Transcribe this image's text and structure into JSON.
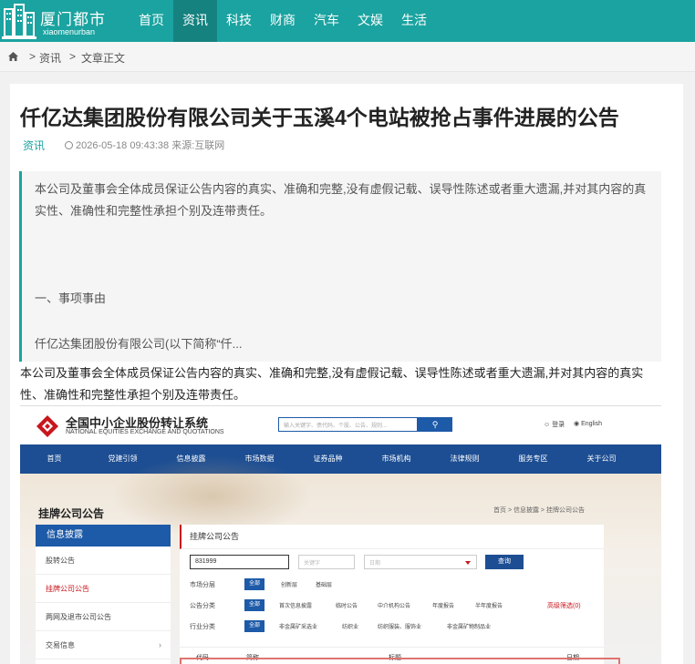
{
  "site": {
    "logo_cn": "厦门都市",
    "logo_en": "xiaomenurban",
    "nav": [
      "首页",
      "资讯",
      "科技",
      "财商",
      "汽车",
      "文娱",
      "生活"
    ],
    "active_nav": "资讯"
  },
  "breadcrumb": {
    "sep1": ">",
    "item1": "资讯",
    "sep2": ">",
    "item2": "文章正文"
  },
  "article": {
    "title": "仟亿达集团股份有限公司关于玉溪4个电站被抢占事件进展的公告",
    "category": "资讯",
    "datetime_source": "2026-05-18 09:43:38 来源:互联网",
    "summary_p1": "本公司及董事会全体成员保证公告内容的真实、准确和完整,没有虚假记载、误导性陈述或者重大遗漏,并对其内容的真实性、准确性和完整性承担个别及连带责任。",
    "summary_p2": "一、事项事由",
    "summary_p3": "仟亿达集团股份有限公司(以下简称“仟...",
    "body_p1": "本公司及董事会全体成员保证公告内容的真实、准确和完整,没有虚假记载、误导性陈述或者重大遗漏,并对其内容的真实性、准确性和完整性承担个别及连带责任。"
  },
  "embedded": {
    "brand_cn": "全国中小企业股份转让系统",
    "brand_en": "NATIONAL EQUITIES EXCHANGE AND QUOTATIONS",
    "search_placeholder": "输入关键字、债代码、个股、公告、规则...",
    "login": "登录",
    "english": "English",
    "nav": [
      "首页",
      "党建引领",
      "信息披露",
      "市场数据",
      "证券品种",
      "市场机构",
      "法律规则",
      "服务专区",
      "关于公司"
    ],
    "page_title": "挂牌公司公告",
    "crumb": "首页 > 信息披露 > 挂牌公司公告",
    "side_header": "信息披露",
    "side_items": [
      "股转公告",
      "挂牌公司公告",
      "两网及退市公司公告",
      "交易信息"
    ],
    "side_arrow": "›",
    "main_title": "挂牌公司公告",
    "code_value": "831999",
    "keyword_placeholder": "关键字",
    "date_placeholder": "日期",
    "query_button": "查询",
    "filter_market_label": "市场分层",
    "filter_market_all": "全部",
    "filter_market_opts": [
      "创新层",
      "基础层"
    ],
    "filter_type_label": "公告分类",
    "filter_type_all": "全部",
    "filter_type_opts": [
      "首次信息披露",
      "临时公告",
      "中介机构公告",
      "年度报告",
      "半年度报告"
    ],
    "advanced_filter": "高级筛选(0)",
    "filter_industry_label": "行业分类",
    "filter_industry_all": "全部",
    "filter_industry_opts": [
      "非金属矿采选业",
      "纺织业",
      "纺织服装、服饰业",
      "非金属矿物制品业"
    ],
    "table_headers": [
      "代码",
      "简称",
      "标题",
      "日期"
    ]
  },
  "colors": {
    "header_bg": "#1aa3a0",
    "active_nav_bg": "#15827f",
    "quote_border": "#1aa3a0",
    "embedded_nav": "#1d4e93",
    "embedded_accent": "#c8161d"
  }
}
